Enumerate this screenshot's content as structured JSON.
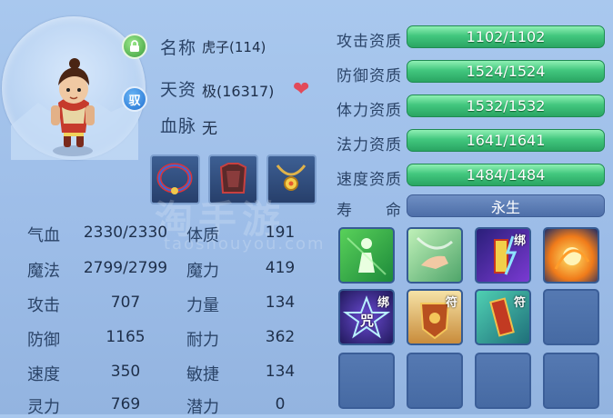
{
  "pet": {
    "name_label": "名称",
    "name_value": "虎子(114)",
    "talent_label": "天资",
    "talent_value": "极(16317)",
    "bloodline_label": "血脉",
    "bloodline_value": "无",
    "lock_icon": "lock-icon",
    "bind_badge": "驭"
  },
  "stats": [
    {
      "label": "气血",
      "value": "2330/2330",
      "label2": "体质",
      "value2": "191"
    },
    {
      "label": "魔法",
      "value": "2799/2799",
      "label2": "魔力",
      "value2": "419"
    },
    {
      "label": "攻击",
      "value": "707",
      "label2": "力量",
      "value2": "134"
    },
    {
      "label": "防御",
      "value": "1165",
      "label2": "耐力",
      "value2": "362"
    },
    {
      "label": "速度",
      "value": "350",
      "label2": "敏捷",
      "value2": "134"
    },
    {
      "label": "灵力",
      "value": "769",
      "label2": "潜力",
      "value2": "0"
    }
  ],
  "aptitudes": [
    {
      "label": "攻击资质",
      "value": "1102/1102"
    },
    {
      "label": "防御资质",
      "value": "1524/1524"
    },
    {
      "label": "体力资质",
      "value": "1532/1532"
    },
    {
      "label": "法力资质",
      "value": "1641/1641"
    },
    {
      "label": "速度资质",
      "value": "1484/1484"
    }
  ],
  "lifespan": {
    "label_a": "寿",
    "label_b": "命",
    "value": "永生"
  },
  "skills": [
    {
      "icon": "green-figure-skill-icon"
    },
    {
      "icon": "finger-point-skill-icon"
    },
    {
      "icon": "lightning-talisman-skill-icon",
      "tag": "绑"
    },
    {
      "icon": "fire-orb-skill-icon"
    },
    {
      "icon": "star-curse-skill-icon",
      "tag": "绑",
      "center": "咒"
    },
    {
      "icon": "shield-talisman-skill-icon",
      "tag": "符"
    },
    {
      "icon": "sword-talisman-skill-icon",
      "tag": "符"
    }
  ],
  "watermark": {
    "line1": "淘手游",
    "line2": "taoshouyou.com"
  },
  "colors": {
    "aptitude_bar": "#42c77e",
    "panel_bg": "#a9c8ee",
    "life_bar": "#4d6ea8"
  }
}
